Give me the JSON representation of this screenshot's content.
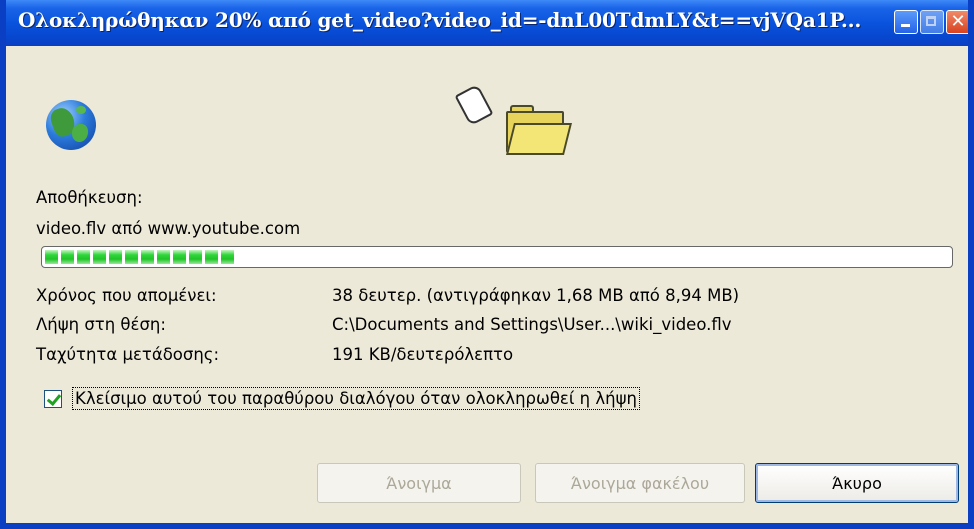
{
  "window": {
    "title": "Ολοκληρώθηκαν 20% από get_video?video_id=-dnL00TdmLY&t==vjVQa1P...",
    "minimize_icon": "minimize-icon",
    "maximize_icon": "maximize-icon",
    "close_icon": "close-icon",
    "close_glyph": "✕"
  },
  "icons": {
    "source": "globe-icon",
    "transfer": "flying-paper-icon",
    "destination": "folder-icon"
  },
  "saving": {
    "heading": "Αποθήκευση:",
    "file_line": "video.flv από www.youtube.com"
  },
  "progress": {
    "percent": 20,
    "segments": 12,
    "color": "#20c427"
  },
  "details": {
    "time_left_label": "Χρόνος που απομένει:",
    "time_left_value": "38 δευτερ. (αντιγράφηκαν 1,68 MB από 8,94 MB)",
    "download_to_label": "Λήψη στη θέση:",
    "download_to_value": "C:\\Documents and Settings\\User...\\wiki_video.flv",
    "rate_label": "Ταχύτητα μετάδοσης:",
    "rate_value": "191 KB/δευτερόλεπτο"
  },
  "close_when_done": {
    "checked": true,
    "label": "Κλείσιμο αυτού του παραθύρου διαλόγου όταν ολοκληρωθεί η λήψη"
  },
  "buttons": {
    "open": "Άνοιγμα",
    "open_folder": "Άνοιγμα φακέλου",
    "cancel": "Άκυρο"
  },
  "colors": {
    "titlebar": "#0a53dd",
    "window_bg": "#ece9d8",
    "progress_fill": "#20c427"
  }
}
